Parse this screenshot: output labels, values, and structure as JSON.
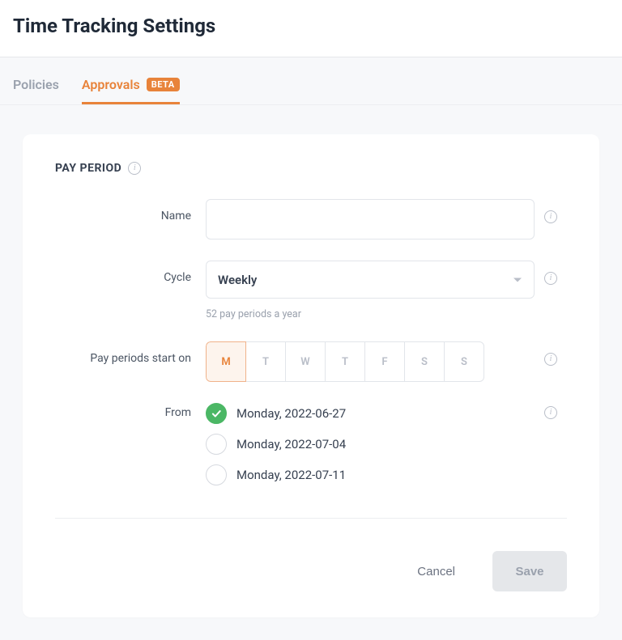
{
  "header": {
    "title": "Time Tracking Settings"
  },
  "tabs": {
    "policies": "Policies",
    "approvals": "Approvals",
    "badge": "BETA"
  },
  "section": {
    "title": "PAY PERIOD"
  },
  "form": {
    "name": {
      "label": "Name",
      "value": ""
    },
    "cycle": {
      "label": "Cycle",
      "value": "Weekly",
      "helper": "52 pay periods a year"
    },
    "start_on": {
      "label": "Pay periods start on",
      "days": [
        "M",
        "T",
        "W",
        "T",
        "F",
        "S",
        "S"
      ],
      "selected_index": 0
    },
    "from": {
      "label": "From",
      "options": [
        "Monday, 2022-06-27",
        "Monday, 2022-07-04",
        "Monday, 2022-07-11"
      ],
      "selected_index": 0
    }
  },
  "footer": {
    "cancel": "Cancel",
    "save": "Save"
  }
}
